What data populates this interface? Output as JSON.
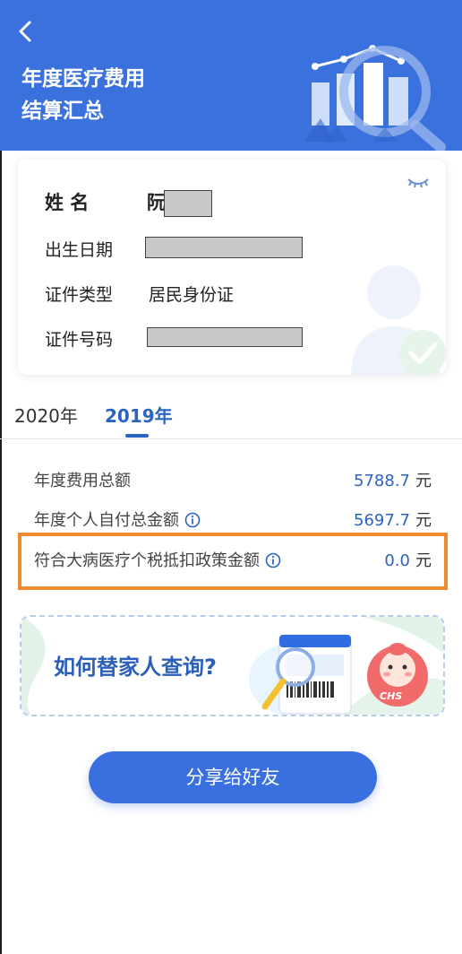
{
  "header": {
    "title_line1": "年度医疗费用",
    "title_line2": "结算汇总"
  },
  "card": {
    "name_label": "姓 名",
    "name_value": "阮",
    "birth_label": "出生日期",
    "idtype_label": "证件类型",
    "idtype_value": "居民身份证",
    "idnum_label": "证件号码"
  },
  "tabs": [
    {
      "label": "2020年",
      "active": false
    },
    {
      "label": "2019年",
      "active": true
    }
  ],
  "summary": {
    "total_label": "年度费用总额",
    "total_value": "5788.7",
    "selfpay_label": "年度个人自付总金额",
    "selfpay_value": "5697.7",
    "tax_label": "符合大病医疗个税抵扣政策金额",
    "tax_value": "0.0",
    "unit": "元"
  },
  "banner": {
    "text": "如何替家人查询?",
    "mascot_badge": "CHS"
  },
  "share_label": "分享给好友",
  "colors": {
    "header_bg": "#3a71dd",
    "accent": "#2b63c3",
    "highlight": "#ef8a2f",
    "button": "#3a6fe0"
  }
}
